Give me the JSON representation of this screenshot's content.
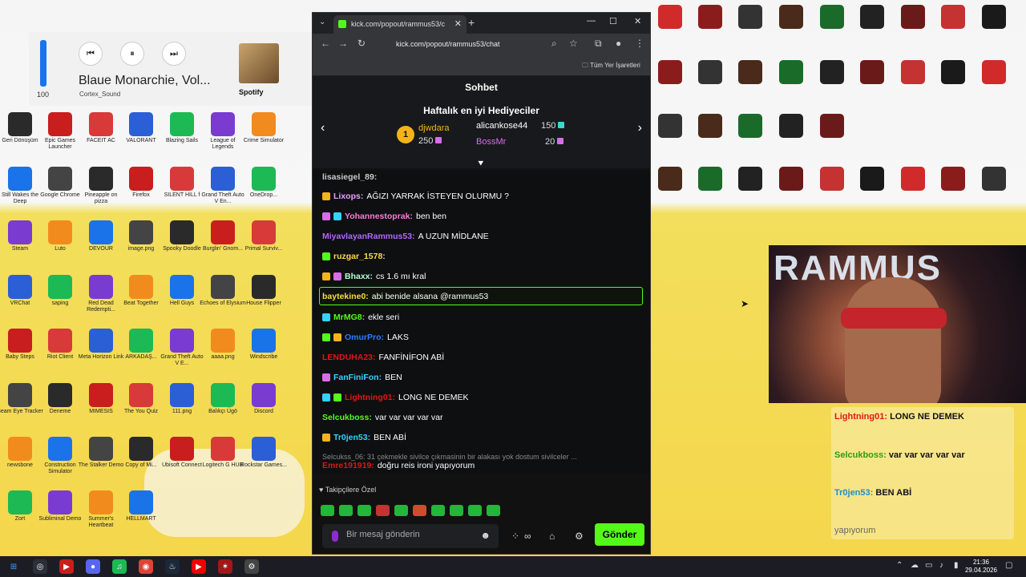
{
  "spotify": {
    "volume": "100",
    "track": "Blaue Monarchie, Vol...",
    "artist": "Cortex_Sound",
    "brand": "Spotify",
    "controls": [
      "prev",
      "pause",
      "next"
    ]
  },
  "browser": {
    "tab_title": "kick.com/popout/rammus53/c",
    "url": "kick.com/popout/rammus53/chat",
    "bookmarks_folder": "Tüm Yer İşaretleri"
  },
  "chat": {
    "header": "Sohbet",
    "gifters_title": "Haftalık en iyi Hediyeciler",
    "gifters": [
      {
        "rank": "1",
        "name": "djwdara",
        "count": "250"
      },
      {
        "name": "alicankose44",
        "count": "150"
      },
      {
        "name": "BossMr",
        "count": "20"
      }
    ],
    "messages": [
      {
        "user": "lisasiegel_89:",
        "text": "",
        "color": "#c9c9c9"
      },
      {
        "user": "Lixops:",
        "text": "AĞIZI YARRAK İSTEYEN OLURMU ?",
        "color": "#e6a1ff"
      },
      {
        "user": "Yohannestoprak:",
        "text": "ben ben",
        "color": "#ff7ad9"
      },
      {
        "user": "MiyavlayanRammus53:",
        "text": "A UZUN MİDLANE",
        "color": "#b366ff"
      },
      {
        "user": "ruzgar_1578:",
        "text": "",
        "color": "#ffd84a"
      },
      {
        "user": "Bhaxx:",
        "text": "cs 1.6 mı kral",
        "color": "#b3ffd9"
      },
      {
        "user": "baytekine0:",
        "text": "abi benide alsana @rammus53",
        "color": "#ffd84a"
      },
      {
        "user": "MrMG8:",
        "text": "ekle seri",
        "color": "#53fc18"
      },
      {
        "user": "OmurPro:",
        "text": "LAKS",
        "color": "#2f7bff"
      },
      {
        "user": "LENDUHA23:",
        "text": "FANFİNİFON ABİ",
        "color": "#e01616"
      },
      {
        "user": "FanFiniFon:",
        "text": "BEN",
        "color": "#32d3ff"
      },
      {
        "user": "Lightning01:",
        "text": "LONG NE DEMEK",
        "color": "#e01616"
      },
      {
        "user": "Selcukboss:",
        "text": "var var var var var",
        "color": "#53fc18"
      },
      {
        "user": "Tr0jen53:",
        "text": "BEN ABİ",
        "color": "#32d3ff"
      }
    ],
    "reply_line": "Selcukss_06: 31 çekmekle sivilce çıkmasinin bir alakası yok dostum sivilceler ...",
    "reply_msg": {
      "user": "Emre191919:",
      "text": "doğru reis ironi yapıyorum",
      "color": "#e01616"
    },
    "follow_label": "Takipçilere Özel",
    "input_placeholder": "Bir mesaj gönderin",
    "send_label": "Gönder"
  },
  "overlay": {
    "messages": [
      {
        "user": "Lightning01:",
        "text": "LONG NE DEMEK"
      },
      {
        "user": "Selcukboss:",
        "text": "var var var var var"
      },
      {
        "user": "Tr0jen53:",
        "text": "BEN ABİ"
      }
    ],
    "tail": "yapıyorum"
  },
  "cam_text": "RAMMUS",
  "taskbar": {
    "time": "21:36",
    "date": "29.04.2026"
  },
  "desktop_icons": [
    "Geri Dönüşüm",
    "Epic Games Launcher",
    "FACEIT AC",
    "VALORANT",
    "Blazing Sails",
    "League of Legends",
    "Crime Simulator",
    "Still Wakes the Deep",
    "Google Chrome",
    "Pineapple on pizza",
    "Firefox",
    "SILENT HILL f",
    "Grand Theft Auto V En...",
    "OneDrop...",
    "Steam",
    "Luto",
    "DEVOUR",
    "image.png",
    "Spooky Doodle",
    "Burglin' Gnom...",
    "Primal Surviv...",
    "VRChat",
    "saping",
    "Red Dead Redempti...",
    "Beat Together",
    "Hell Guys",
    "Echoes of Elysium",
    "House Flipper",
    "Baby Steps",
    "Riot Client",
    "Meta Horizon Link",
    "ARKADAŞ...",
    "Grand Theft Auto V E...",
    "aaaa.png",
    "Windscribe",
    "Beam Eye Tracker",
    "Deneme",
    "MIMESIS",
    "The You Quiz",
    "111.png",
    "Balıkçı Ügö",
    "Discord",
    "newsbone",
    "Construction Simulator",
    "The Stalker Demo",
    "Copy of Mi...",
    "Ubisoft Connect",
    "Logitech G HUB",
    "Rockstar Games...",
    "Zort",
    "Subliminal Demo",
    "Summer's Heartbeat",
    "HELLMART"
  ]
}
